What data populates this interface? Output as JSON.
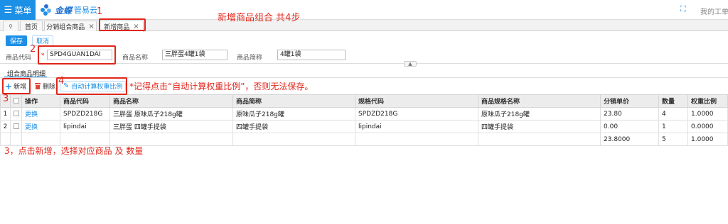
{
  "header": {
    "menu_label": "菜单",
    "logo_name": "金蝶",
    "logo_sub": "管易云",
    "right_text": "我的工单"
  },
  "tabs": [
    {
      "label": "首页"
    },
    {
      "label": "分销组合商品"
    },
    {
      "label": "新增商品"
    }
  ],
  "toolbar": {
    "save_label": "保存",
    "cancel_label": "取消"
  },
  "form": {
    "code_label": "商品代码",
    "code_value": "SPD4GUAN1DAI",
    "name_label": "商品名称",
    "name_value": "三胖蛋4罐1袋",
    "short_label": "商品简称",
    "short_value": "4罐1袋"
  },
  "detail": {
    "section_title": "组合商品明细",
    "add_label": "新增",
    "delete_label": "删除",
    "calc_label": "自动计算权重比例",
    "columns": [
      "操作",
      "商品代码",
      "商品名称",
      "商品简称",
      "规格代码",
      "商品规格名称",
      "分销单价",
      "数量",
      "权重比例"
    ],
    "rows": [
      {
        "idx": "1",
        "op": "更换",
        "code": "SPDZD218G",
        "name": "三胖蛋 原味瓜子218g罐",
        "short": "原味瓜子218g罐",
        "sku": "SPDZD218G",
        "sku_name": "原味瓜子218g罐",
        "price": "23.80",
        "qty": "4",
        "weight": "1.0000"
      },
      {
        "idx": "2",
        "op": "更换",
        "code": "lipindai",
        "name": "三胖蛋 四罐手提袋",
        "short": "四罐手提袋",
        "sku": "lipindai",
        "sku_name": "四罐手提袋",
        "price": "0.00",
        "qty": "1",
        "weight": "0.0000"
      }
    ],
    "summary": {
      "price": "23.8000",
      "qty": "5",
      "weight": "1.0000"
    }
  },
  "annotations": {
    "n1": "1",
    "n2": "2",
    "n3": "3",
    "n4": "4",
    "title": "新增商品组合 共4步",
    "note4": "*记得点击“自动计算权重比例”，否则无法保存。",
    "note3": "3，点击新增，选择对应商品 及 数量"
  },
  "colors": {
    "accent": "#1c8fe6",
    "annotation": "#e0261b"
  }
}
